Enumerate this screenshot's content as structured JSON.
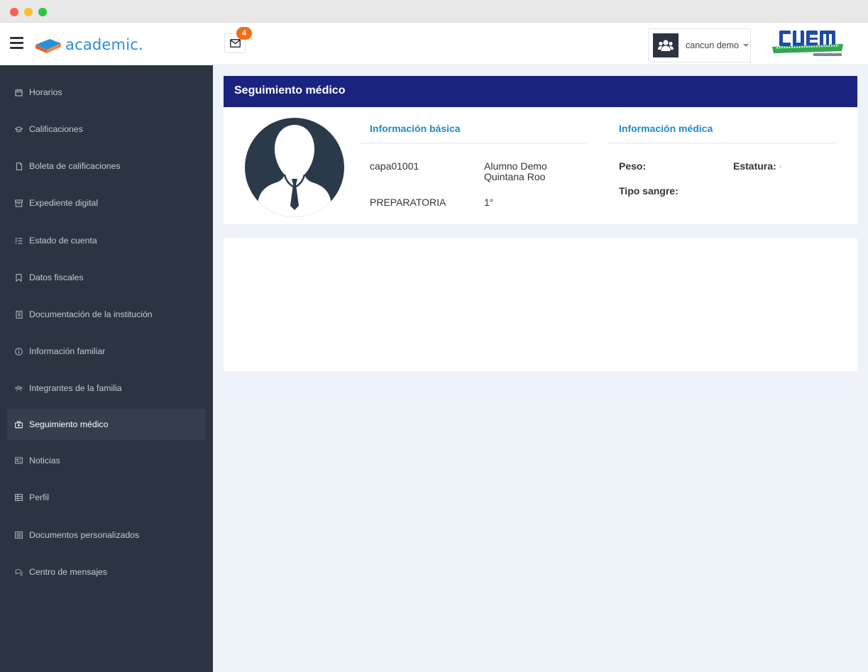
{
  "header": {
    "logo_text": "academic.",
    "mail_count": "4",
    "user_name": "cancun demo"
  },
  "sidebar": {
    "items": [
      {
        "label": "Horarios",
        "icon": "calendar-icon",
        "active": false
      },
      {
        "label": "Calificaciones",
        "icon": "graduation-cap-icon",
        "active": false
      },
      {
        "label": "Boleta de calificaciones",
        "icon": "file-icon",
        "active": false
      },
      {
        "label": "Expediente digital",
        "icon": "archive-icon",
        "active": false
      },
      {
        "label": "Estado de cuenta",
        "icon": "list-check-icon",
        "active": false
      },
      {
        "label": "Datos fiscales",
        "icon": "bookmark-icon",
        "active": false
      },
      {
        "label": "Documentación de la institución",
        "icon": "book-icon",
        "active": false
      },
      {
        "label": "Información familiar",
        "icon": "info-circle-icon",
        "active": false
      },
      {
        "label": "Integrantes de la familia",
        "icon": "users-icon",
        "active": false
      },
      {
        "label": "Seguimiento médico",
        "icon": "medkit-icon",
        "active": true
      },
      {
        "label": "Noticias",
        "icon": "newspaper-icon",
        "active": false
      },
      {
        "label": "Perfil",
        "icon": "table-icon",
        "active": false
      },
      {
        "label": "Documentos personalizados",
        "icon": "list-alt-icon",
        "active": false
      },
      {
        "label": "Centro de mensajes",
        "icon": "comments-icon",
        "active": false
      }
    ]
  },
  "main": {
    "title": "Seguimiento médico",
    "basic": {
      "title": "Información básica",
      "id": "capa01001",
      "name_line1": "Alumno Demo",
      "name_line2": "Quintana Roo",
      "level": "PREPARATORIA",
      "grade": "1°"
    },
    "medical": {
      "title": "Información médica",
      "weight_label": "Peso:",
      "height_label": "Estatura:",
      "height_value": "-",
      "blood_label": "Tipo sangre:"
    }
  },
  "colors": {
    "sidebar_bg": "#2b3440",
    "header_bar": "#1a237e",
    "accent": "#1f8bc7",
    "badge": "#f36c17",
    "logo_blue": "#2a8fd6"
  }
}
